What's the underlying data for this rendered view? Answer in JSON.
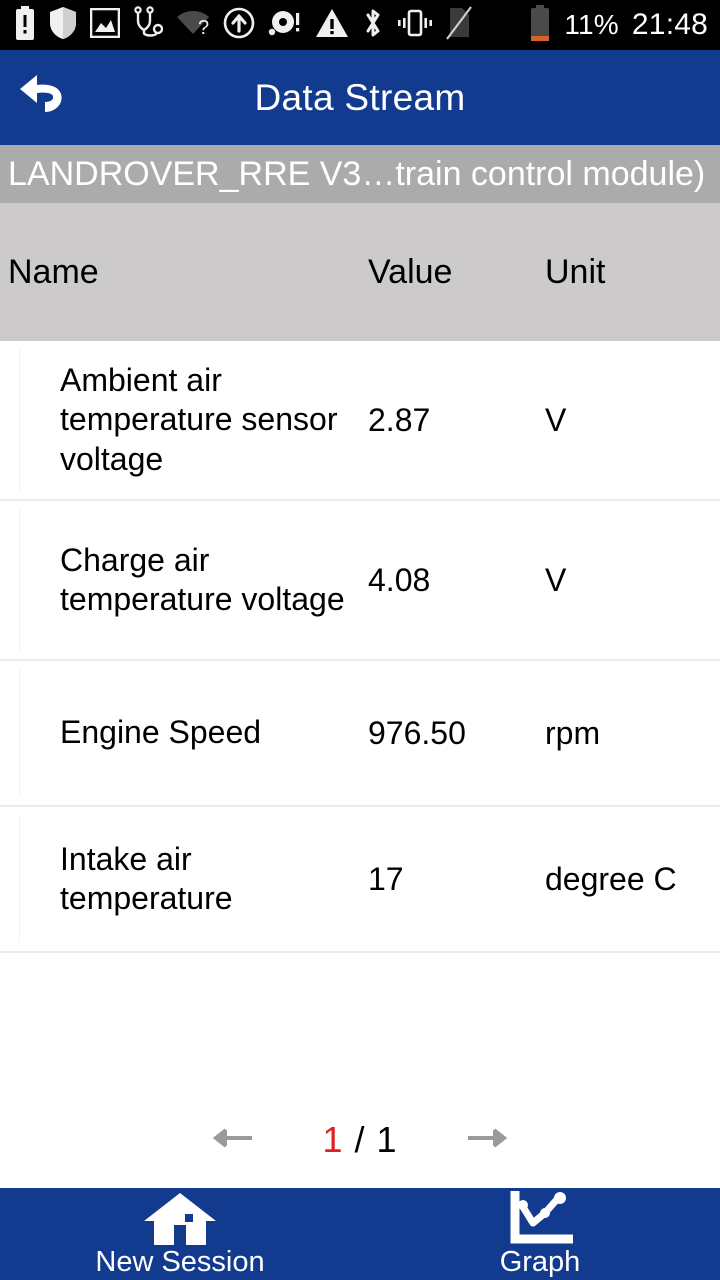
{
  "status_bar": {
    "icons": [
      "battery-alert-icon",
      "shield-icon",
      "image-icon",
      "stethoscope-icon",
      "wifi-unknown-icon",
      "arrow-up-circle-icon",
      "disc-alert-icon",
      "warning-triangle-icon",
      "bluetooth-icon",
      "vibrate-icon",
      "no-sim-icon",
      "battery-low-icon"
    ],
    "battery_percent": "11%",
    "clock": "21:48"
  },
  "app_bar": {
    "title": "Data Stream",
    "back_icon": "back-arrow-icon"
  },
  "subtitle": {
    "text": "LANDROVER_RRE V3…train control module)"
  },
  "table": {
    "headers": {
      "name": "Name",
      "value": "Value",
      "unit": "Unit"
    },
    "rows": [
      {
        "name": "Ambient air temperature sensor voltage",
        "value": "2.87",
        "unit": "V"
      },
      {
        "name": "Charge air temperature voltage",
        "value": "4.08",
        "unit": "V"
      },
      {
        "name": "Engine Speed",
        "value": "976.50",
        "unit": "rpm"
      },
      {
        "name": "Intake air temperature",
        "value": "17",
        "unit": "degree C"
      }
    ]
  },
  "pagination": {
    "prev_icon": "arrow-left-icon",
    "next_icon": "arrow-right-icon",
    "current_page": "1",
    "separator": "/",
    "total_pages": "1"
  },
  "bottom_nav": {
    "items": [
      {
        "label": "New Session",
        "icon": "home-icon"
      },
      {
        "label": "Graph",
        "icon": "line-chart-icon"
      }
    ]
  },
  "colors": {
    "header_blue": "#123a8f",
    "subtitle_gray": "#ababab",
    "table_header_gray": "#cccaca",
    "page_current_red": "#e02020",
    "status_bar_black": "#000000"
  }
}
